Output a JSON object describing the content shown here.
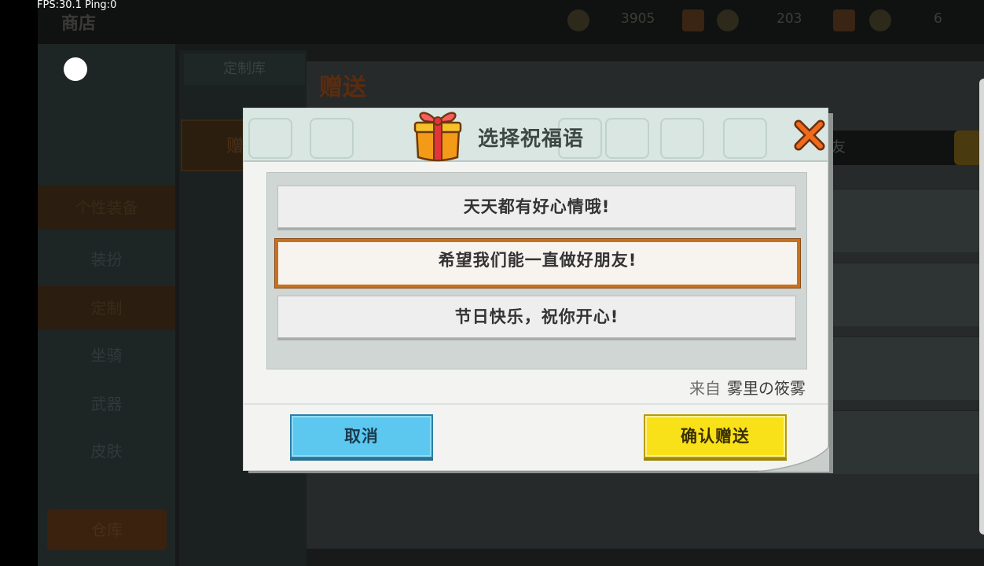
{
  "overlay": {
    "fps_text": "FPS:30.1  Ping:0"
  },
  "background": {
    "app_title": "商店",
    "currency": [
      "3905",
      "203",
      "6"
    ],
    "sidebar_items": [
      "",
      "",
      "个性装备",
      "装扮",
      "定制",
      "坐骑",
      "武器",
      "皮肤"
    ],
    "sidebar_bottom": "仓库",
    "subtab": "定制库",
    "subactive": "赠",
    "main_title": "赠送",
    "search_text": "友"
  },
  "dialog": {
    "title": "选择祝福语",
    "options": [
      {
        "label": "天天都有好心情哦!",
        "selected": false
      },
      {
        "label": "希望我们能一直做好朋友!",
        "selected": true
      },
      {
        "label": "节日快乐，祝你开心!",
        "selected": false
      }
    ],
    "from_label": "来自",
    "from_name": "雾里の筱雾",
    "cancel_label": "取消",
    "confirm_label": "确认赠送"
  },
  "colors": {
    "selected_border": "#c6711e",
    "cancel_button": "#5cc8f0",
    "confirm_button": "#f9e11a",
    "close_icon": "#f06a1a"
  }
}
